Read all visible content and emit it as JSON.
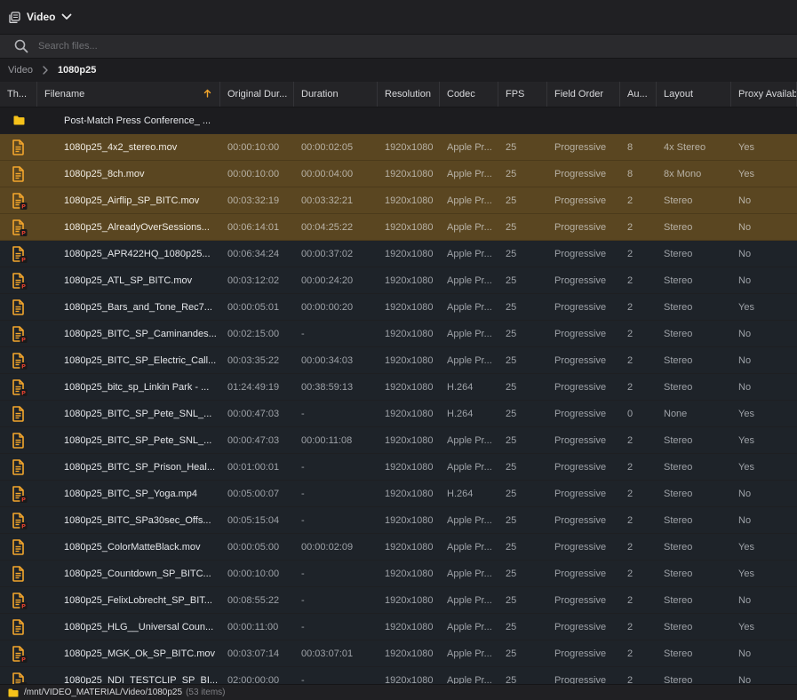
{
  "topbar": {
    "title": "Video"
  },
  "search": {
    "placeholder": "Search files..."
  },
  "breadcrumb": [
    "Video",
    "1080p25"
  ],
  "columns": [
    {
      "label": "Th..."
    },
    {
      "label": "Filename"
    },
    {
      "label": "Original Dur..."
    },
    {
      "label": "Duration"
    },
    {
      "label": "Resolution"
    },
    {
      "label": "Codec"
    },
    {
      "label": "FPS"
    },
    {
      "label": "Field Order"
    },
    {
      "label": "Au..."
    },
    {
      "label": "Layout"
    },
    {
      "label": "Proxy Availab"
    }
  ],
  "sort": {
    "column": "Filename",
    "direction": "ascending"
  },
  "colors": {
    "selected_row": "#5a4621",
    "icon_orange": "#f3a62c",
    "proxy_badge": "#c0392b",
    "folder": "#f6c21a"
  },
  "folder": {
    "name": "Post-Match Press Conference_ ..."
  },
  "rows": [
    {
      "name": "1080p25_4x2_stereo.mov",
      "orig": "00:00:10:00",
      "dur": "00:00:02:05",
      "res": "1920x1080",
      "codec": "Apple Pr...",
      "fps": "25",
      "field": "Progressive",
      "au": "8",
      "layout": "4x Stereo",
      "proxy": "Yes",
      "badge": false,
      "selected": true
    },
    {
      "name": "1080p25_8ch.mov",
      "orig": "00:00:10:00",
      "dur": "00:00:04:00",
      "res": "1920x1080",
      "codec": "Apple Pr...",
      "fps": "25",
      "field": "Progressive",
      "au": "8",
      "layout": "8x Mono",
      "proxy": "Yes",
      "badge": false,
      "selected": true
    },
    {
      "name": "1080p25_Airflip_SP_BITC.mov",
      "orig": "00:03:32:19",
      "dur": "00:03:32:21",
      "res": "1920x1080",
      "codec": "Apple Pr...",
      "fps": "25",
      "field": "Progressive",
      "au": "2",
      "layout": "Stereo",
      "proxy": "No",
      "badge": true,
      "selected": true
    },
    {
      "name": "1080p25_AlreadyOverSessions...",
      "orig": "00:06:14:01",
      "dur": "00:04:25:22",
      "res": "1920x1080",
      "codec": "Apple Pr...",
      "fps": "25",
      "field": "Progressive",
      "au": "2",
      "layout": "Stereo",
      "proxy": "No",
      "badge": true,
      "selected": true
    },
    {
      "name": "1080p25_APR422HQ_1080p25...",
      "orig": "00:06:34:24",
      "dur": "00:00:37:02",
      "res": "1920x1080",
      "codec": "Apple Pr...",
      "fps": "25",
      "field": "Progressive",
      "au": "2",
      "layout": "Stereo",
      "proxy": "No",
      "badge": true,
      "selected": false
    },
    {
      "name": "1080p25_ATL_SP_BITC.mov",
      "orig": "00:03:12:02",
      "dur": "00:00:24:20",
      "res": "1920x1080",
      "codec": "Apple Pr...",
      "fps": "25",
      "field": "Progressive",
      "au": "2",
      "layout": "Stereo",
      "proxy": "No",
      "badge": true,
      "selected": false
    },
    {
      "name": "1080p25_Bars_and_Tone_Rec7...",
      "orig": "00:00:05:01",
      "dur": "00:00:00:20",
      "res": "1920x1080",
      "codec": "Apple Pr...",
      "fps": "25",
      "field": "Progressive",
      "au": "2",
      "layout": "Stereo",
      "proxy": "Yes",
      "badge": false,
      "selected": false
    },
    {
      "name": "1080p25_BITC_SP_Caminandes...",
      "orig": "00:02:15:00",
      "dur": "-",
      "res": "1920x1080",
      "codec": "Apple Pr...",
      "fps": "25",
      "field": "Progressive",
      "au": "2",
      "layout": "Stereo",
      "proxy": "No",
      "badge": true,
      "selected": false
    },
    {
      "name": "1080p25_BITC_SP_Electric_Call...",
      "orig": "00:03:35:22",
      "dur": "00:00:34:03",
      "res": "1920x1080",
      "codec": "Apple Pr...",
      "fps": "25",
      "field": "Progressive",
      "au": "2",
      "layout": "Stereo",
      "proxy": "No",
      "badge": true,
      "selected": false
    },
    {
      "name": "1080p25_bitc_sp_Linkin Park - ...",
      "orig": "01:24:49:19",
      "dur": "00:38:59:13",
      "res": "1920x1080",
      "codec": "H.264",
      "fps": "25",
      "field": "Progressive",
      "au": "2",
      "layout": "Stereo",
      "proxy": "No",
      "badge": true,
      "selected": false
    },
    {
      "name": "1080p25_BITC_SP_Pete_SNL_...",
      "orig": "00:00:47:03",
      "dur": "-",
      "res": "1920x1080",
      "codec": "H.264",
      "fps": "25",
      "field": "Progressive",
      "au": "0",
      "layout": "None",
      "proxy": "Yes",
      "badge": false,
      "selected": false
    },
    {
      "name": "1080p25_BITC_SP_Pete_SNL_...",
      "orig": "00:00:47:03",
      "dur": "00:00:11:08",
      "res": "1920x1080",
      "codec": "Apple Pr...",
      "fps": "25",
      "field": "Progressive",
      "au": "2",
      "layout": "Stereo",
      "proxy": "Yes",
      "badge": false,
      "selected": false
    },
    {
      "name": "1080p25_BITC_SP_Prison_Heal...",
      "orig": "00:01:00:01",
      "dur": "-",
      "res": "1920x1080",
      "codec": "Apple Pr...",
      "fps": "25",
      "field": "Progressive",
      "au": "2",
      "layout": "Stereo",
      "proxy": "Yes",
      "badge": false,
      "selected": false
    },
    {
      "name": "1080p25_BITC_SP_Yoga.mp4",
      "orig": "00:05:00:07",
      "dur": "-",
      "res": "1920x1080",
      "codec": "H.264",
      "fps": "25",
      "field": "Progressive",
      "au": "2",
      "layout": "Stereo",
      "proxy": "No",
      "badge": true,
      "selected": false
    },
    {
      "name": "1080p25_BITC_SPa30sec_Offs...",
      "orig": "00:05:15:04",
      "dur": "-",
      "res": "1920x1080",
      "codec": "Apple Pr...",
      "fps": "25",
      "field": "Progressive",
      "au": "2",
      "layout": "Stereo",
      "proxy": "No",
      "badge": true,
      "selected": false
    },
    {
      "name": "1080p25_ColorMatteBlack.mov",
      "orig": "00:00:05:00",
      "dur": "00:00:02:09",
      "res": "1920x1080",
      "codec": "Apple Pr...",
      "fps": "25",
      "field": "Progressive",
      "au": "2",
      "layout": "Stereo",
      "proxy": "Yes",
      "badge": false,
      "selected": false
    },
    {
      "name": "1080p25_Countdown_SP_BITC...",
      "orig": "00:00:10:00",
      "dur": "-",
      "res": "1920x1080",
      "codec": "Apple Pr...",
      "fps": "25",
      "field": "Progressive",
      "au": "2",
      "layout": "Stereo",
      "proxy": "Yes",
      "badge": false,
      "selected": false
    },
    {
      "name": "1080p25_FelixLobrecht_SP_BIT...",
      "orig": "00:08:55:22",
      "dur": "-",
      "res": "1920x1080",
      "codec": "Apple Pr...",
      "fps": "25",
      "field": "Progressive",
      "au": "2",
      "layout": "Stereo",
      "proxy": "No",
      "badge": true,
      "selected": false
    },
    {
      "name": "1080p25_HLG__Universal Coun...",
      "orig": "00:00:11:00",
      "dur": "-",
      "res": "1920x1080",
      "codec": "Apple Pr...",
      "fps": "25",
      "field": "Progressive",
      "au": "2",
      "layout": "Stereo",
      "proxy": "Yes",
      "badge": false,
      "selected": false
    },
    {
      "name": "1080p25_MGK_Ok_SP_BITC.mov",
      "orig": "00:03:07:14",
      "dur": "00:03:07:01",
      "res": "1920x1080",
      "codec": "Apple Pr...",
      "fps": "25",
      "field": "Progressive",
      "au": "2",
      "layout": "Stereo",
      "proxy": "No",
      "badge": true,
      "selected": false
    },
    {
      "name": "1080p25_NDI_TESTCLIP_SP_BI...",
      "orig": "02:00:00:00",
      "dur": "-",
      "res": "1920x1080",
      "codec": "Apple Pr...",
      "fps": "25",
      "field": "Progressive",
      "au": "2",
      "layout": "Stereo",
      "proxy": "No",
      "badge": true,
      "selected": false
    }
  ],
  "status": {
    "path": "/mnt/VIDEO_MATERIAL/Video/1080p25",
    "count": "(53 items)"
  }
}
